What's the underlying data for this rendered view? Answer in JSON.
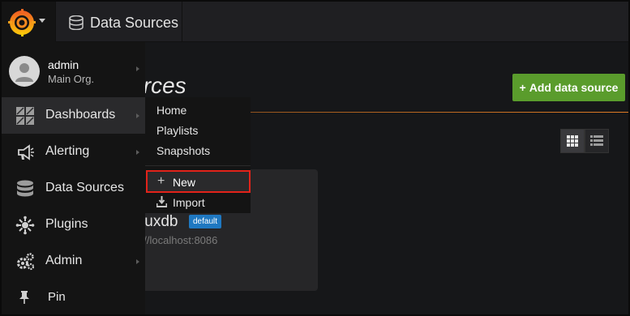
{
  "topnav": {
    "section_label": "Data Sources"
  },
  "page": {
    "title": "Data Sources",
    "add_button_label": "Add data source"
  },
  "datasource_card": {
    "name": "influxdb",
    "badge": "default",
    "url": "http://localhost:8086"
  },
  "sidemenu": {
    "user": {
      "name": "admin",
      "org": "Main Org."
    },
    "items": [
      {
        "label": "Dashboards",
        "icon": "dashboards-icon"
      },
      {
        "label": "Alerting",
        "icon": "alerting-icon"
      },
      {
        "label": "Data Sources",
        "icon": "database-icon"
      },
      {
        "label": "Plugins",
        "icon": "plugins-icon"
      },
      {
        "label": "Admin",
        "icon": "gears-icon"
      },
      {
        "label": "Pin",
        "icon": "pin-icon"
      }
    ]
  },
  "dashboards_dropdown": {
    "items": [
      "Home",
      "Playlists",
      "Snapshots"
    ],
    "new_label": "New",
    "import_label": "Import"
  },
  "colors": {
    "accent_orange": "#e07b24",
    "add_button_green": "#5a9c2c",
    "badge_blue": "#1f78c1",
    "highlight_red": "#e2231a"
  }
}
